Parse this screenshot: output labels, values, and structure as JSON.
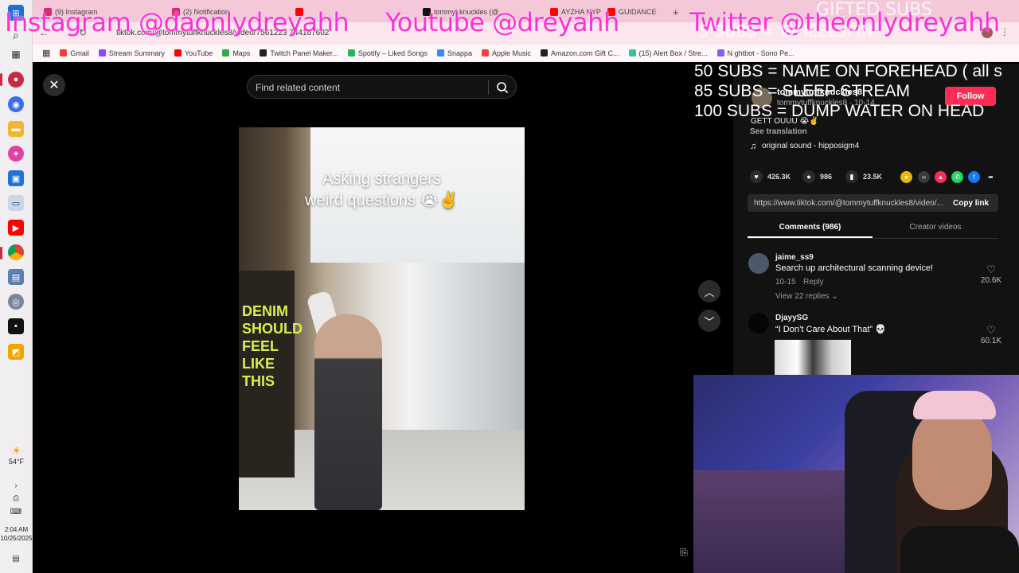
{
  "taskbar": {
    "weather_temp": "54°F",
    "time": "2:04 AM",
    "date": "10/25/2025"
  },
  "browser": {
    "tabs": [
      {
        "label": "(9) Instagram",
        "color": "#d62976"
      },
      {
        "label": "(2) Notification",
        "color": "#d62976"
      },
      {
        "label": "",
        "color": "#ff0000"
      },
      {
        "label": "tommyt  knuckles (@",
        "color": "#111111"
      },
      {
        "label": "AYZHA NYP",
        "color": "#ff0000"
      },
      {
        "label": "GUIDANCE",
        "color": "#ff0000"
      }
    ],
    "address": "tiktok.com/@tommytuffknuckles8/video/7561223   744167602",
    "bookmarks": [
      {
        "label": "Gmail",
        "color": "#ea4335"
      },
      {
        "label": "Stream Summary",
        "color": "#9146ff"
      },
      {
        "label": "YouTube",
        "color": "#ff0000"
      },
      {
        "label": "Maps",
        "color": "#34a853"
      },
      {
        "label": "Twitch Panel Maker...",
        "color": "#222222"
      },
      {
        "label": "Spotify – Liked Songs",
        "color": "#1db954"
      },
      {
        "label": "Snappa",
        "color": "#2d8cff"
      },
      {
        "label": "Apple Music",
        "color": "#fc3c44"
      },
      {
        "label": "Amazon.com Gift C...",
        "color": "#222222"
      },
      {
        "label": "(15) Alert Box / Stre...",
        "color": "#31c3a2"
      },
      {
        "label": "N ghtbot - Sono Pe...",
        "color": "#8a5cf6"
      }
    ]
  },
  "overlay": {
    "instagram": "Instagram @daonlydreyahh",
    "youtube": "Youtube @dreyahh",
    "twitter": "Twitter @theonlydreyahh",
    "gifted": "GIFTED SUBS",
    "wheel": "5 SUBS = WHEELSPIN",
    "goals": [
      "50 SUBS = NAME ON FOREHEAD ( all s",
      "85 SUBS = SLEEP STREAM",
      "100 SUBS = DUMP WATER ON HEAD"
    ]
  },
  "video": {
    "search_placeholder": "Find related content",
    "caption_line1": "Asking strangers",
    "caption_line2": "weird questions 😭✌️",
    "store_sign": "DENIM SHOULD FEEL LIKE THIS"
  },
  "panel": {
    "author": "tommytuffknuckles8",
    "author_sub": "tommytuffknuckles8 · 10-14",
    "follow_label": "Follow",
    "description": "GETT OUUU 😭✌️",
    "translate_label": "See translation",
    "music": "original sound - hipposigm4",
    "stats": {
      "likes": "426.3K",
      "comments": "986",
      "saves": "23.5K"
    },
    "link": "https://www.tiktok.com/@tommytuffknuckles8/video/...",
    "copy_label": "Copy link",
    "tab_comments": "Comments (986)",
    "tab_creator": "Creator videos",
    "comments": [
      {
        "user": "jaime_ss9",
        "text": "Search up architectural scanning device!",
        "date": "10-15",
        "reply": "Reply",
        "view_replies": "View 22 replies",
        "likes": "20.6K"
      },
      {
        "user": "DjayySG",
        "text": "“I Don’t Care About That” 💀",
        "likes": "60.1K"
      }
    ]
  }
}
